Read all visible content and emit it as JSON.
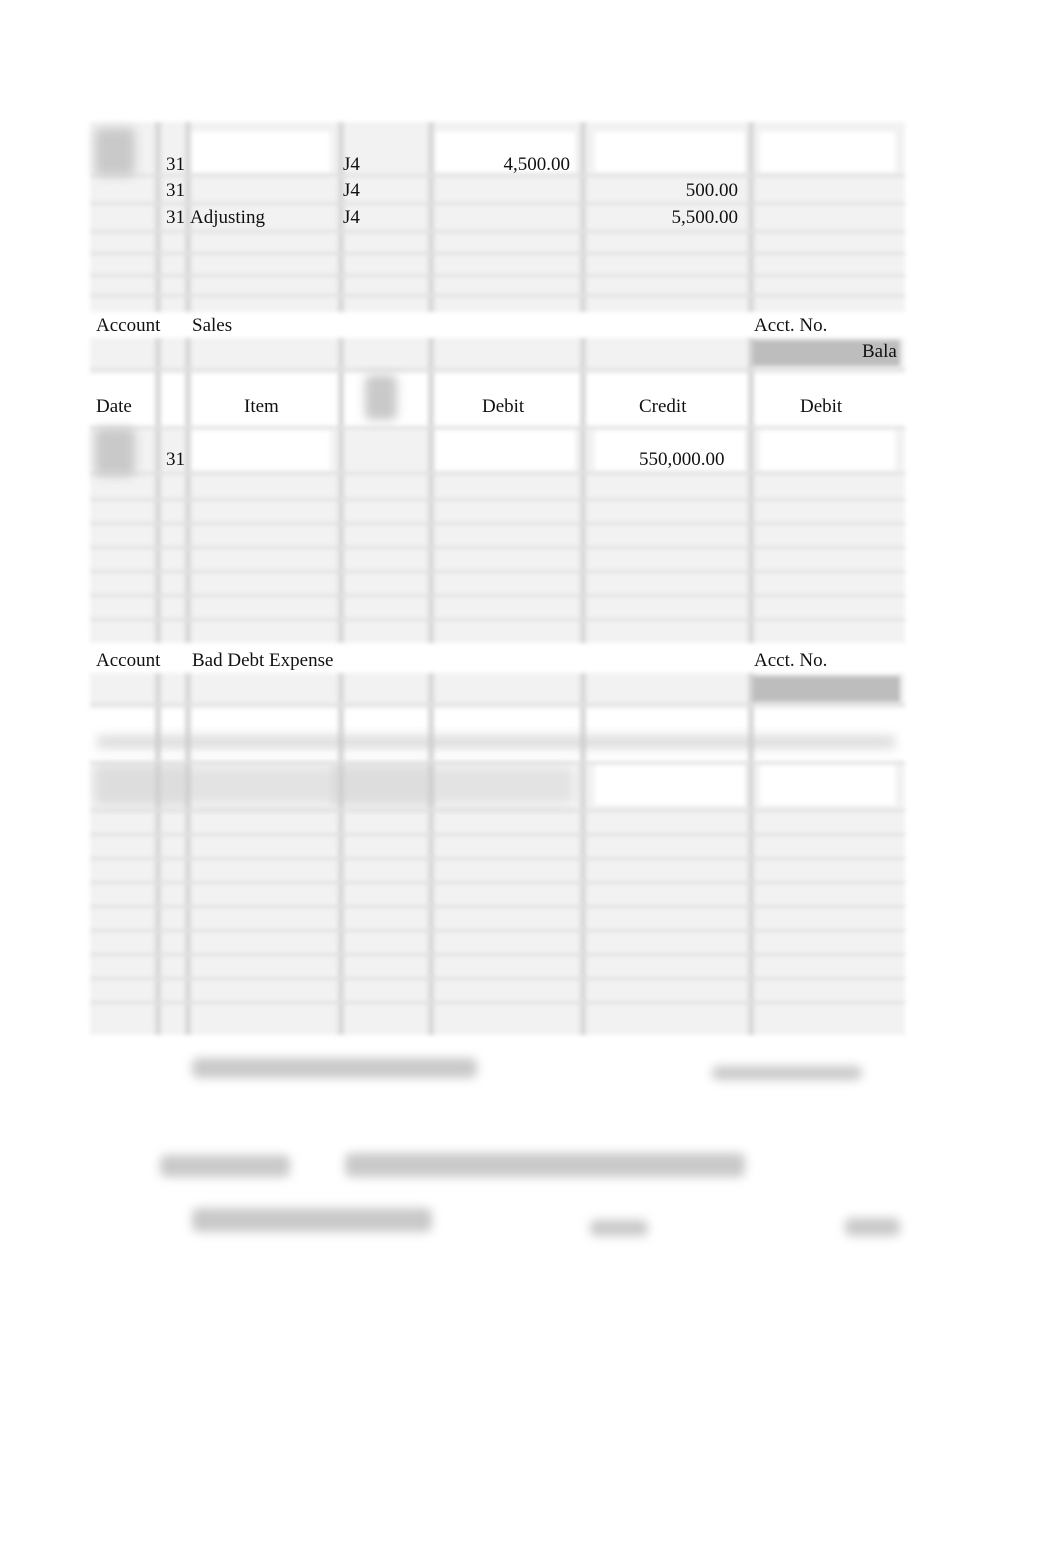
{
  "ledger1": {
    "rows": [
      {
        "day": "31",
        "item": "",
        "ref": "J4",
        "debit": "4,500.00",
        "credit": ""
      },
      {
        "day": "31",
        "item": "",
        "ref": "J4",
        "debit": "",
        "credit": "500.00"
      },
      {
        "day": "31",
        "item": "Adjusting",
        "ref": "J4",
        "debit": "",
        "credit": "5,500.00"
      }
    ]
  },
  "ledger2": {
    "account_label": "Account",
    "account_name": "Sales",
    "acct_no_label": "Acct. No.",
    "balance_header": "Bala",
    "headers": {
      "date": "Date",
      "item": "Item",
      "debit": "Debit",
      "credit": "Credit",
      "balance_debit": "Debit"
    },
    "rows": [
      {
        "day": "31",
        "item": "",
        "ref": "",
        "debit": "",
        "credit": "550,000.00"
      }
    ]
  },
  "ledger3": {
    "account_label": "Account",
    "account_name": "Bad Debt Expense",
    "acct_no_label": "Acct. No."
  }
}
